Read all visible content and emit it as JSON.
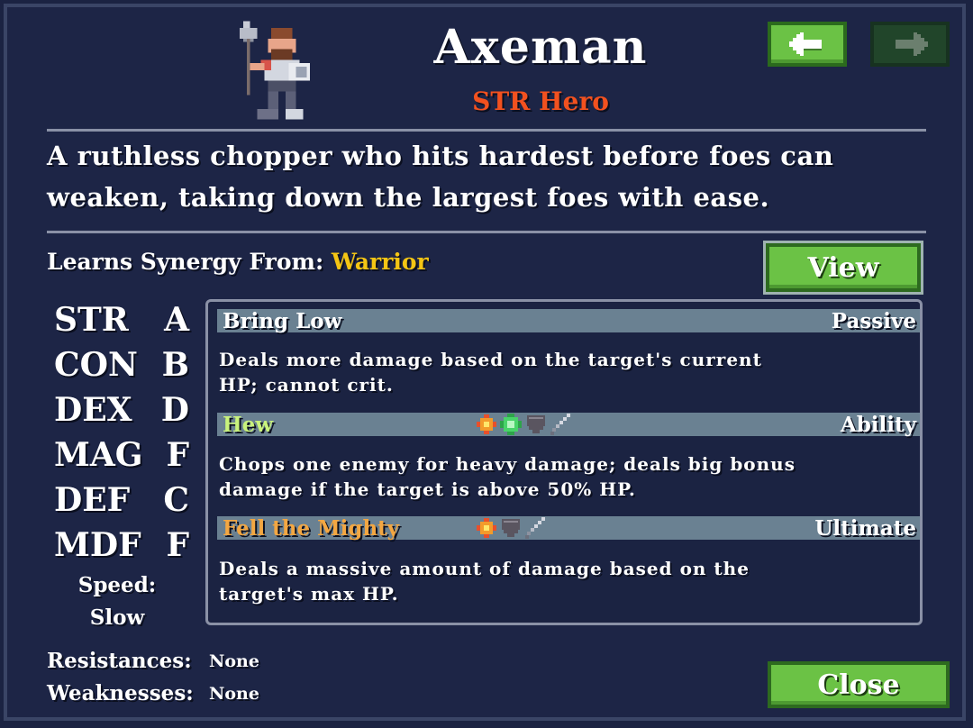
{
  "hero": {
    "name": "Axeman",
    "class_label": "STR Hero",
    "description": "A ruthless chopper who hits hardest before foes can weaken, taking down the largest foes with ease.",
    "sprite_icon": "axeman-sprite-icon"
  },
  "nav": {
    "prev_icon": "arrow-left-icon",
    "next_icon": "arrow-right-icon",
    "next_enabled": false
  },
  "synergy": {
    "label": "Learns Synergy From:",
    "class_name": "Warrior",
    "view_label": "View"
  },
  "stats": [
    {
      "name": "STR",
      "grade": "A"
    },
    {
      "name": "CON",
      "grade": "B"
    },
    {
      "name": "DEX",
      "grade": "D"
    },
    {
      "name": "MAG",
      "grade": "F"
    },
    {
      "name": "DEF",
      "grade": "C"
    },
    {
      "name": "MDF",
      "grade": "F"
    }
  ],
  "speed": {
    "label": "Speed:",
    "value": "Slow"
  },
  "skills": [
    {
      "name": "Bring Low",
      "type": "Passive",
      "name_color": "#ffffff",
      "description": "Deals more damage based on the target's current HP; cannot crit.",
      "icons": []
    },
    {
      "name": "Hew",
      "type": "Ability",
      "name_color": "#c9f27c",
      "description": "Chops one enemy for heavy damage; deals big bonus damage if the target is above 50% HP.",
      "icons": [
        "fire-burst-icon",
        "green-orb-icon",
        "shield-icon",
        "sword-icon"
      ]
    },
    {
      "name": "Fell the Mighty",
      "type": "Ultimate",
      "name_color": "#f3a742",
      "description": "Deals a massive amount of damage based on the target's max HP.",
      "icons": [
        "fire-burst-icon",
        "shield-icon",
        "sword-icon"
      ]
    }
  ],
  "resistances": {
    "label": "Resistances:",
    "value": "None"
  },
  "weaknesses": {
    "label": "Weaknesses:",
    "value": "None"
  },
  "close_label": "Close",
  "colors": {
    "background": "#1d2546",
    "button_green": "#6bc245",
    "class_red": "#f2511f",
    "synergy_yellow": "#f4c514"
  }
}
